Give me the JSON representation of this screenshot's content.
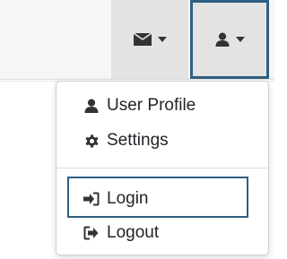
{
  "topbar": {
    "messages_icon": "envelope-icon",
    "user_icon": "user-icon",
    "caret_icon": "caret-down-icon"
  },
  "menu": {
    "items": [
      {
        "label": "User Profile",
        "icon": "user-icon"
      },
      {
        "label": "Settings",
        "icon": "gear-icon"
      },
      {
        "label": "Login",
        "icon": "sign-in-icon"
      },
      {
        "label": "Logout",
        "icon": "sign-out-icon"
      }
    ]
  },
  "colors": {
    "highlight_border": "#2f5f82",
    "icon": "#333333",
    "text": "#212529"
  }
}
